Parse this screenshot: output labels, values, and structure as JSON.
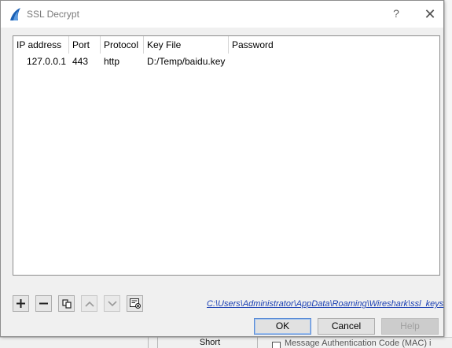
{
  "window": {
    "title": "SSL Decrypt",
    "help_glyph": "?",
    "close_glyph": "✕",
    "accent_color": "#1a5fb4"
  },
  "table": {
    "columns": [
      "IP address",
      "Port",
      "Protocol",
      "Key File",
      "Password"
    ],
    "rows": [
      {
        "ip": "127.0.0.1",
        "port": "443",
        "protocol": "http",
        "key_file": "D:/Temp/baidu.key",
        "password": ""
      }
    ]
  },
  "toolbar": {
    "add_icon": "plus-icon",
    "remove_icon": "minus-icon",
    "copy_icon": "copy-icon",
    "move_up_icon": "arrow-up-icon",
    "move_down_icon": "arrow-down-icon",
    "clear_icon": "clear-list-icon"
  },
  "keys_path": "C:\\Users\\Administrator\\AppData\\Roaming\\Wireshark\\ssl_keys",
  "buttons": {
    "ok": "OK",
    "cancel": "Cancel",
    "help": "Help"
  },
  "background": {
    "short_label": "Short",
    "mac_label": "Message Authentication Code (MAC) i"
  }
}
